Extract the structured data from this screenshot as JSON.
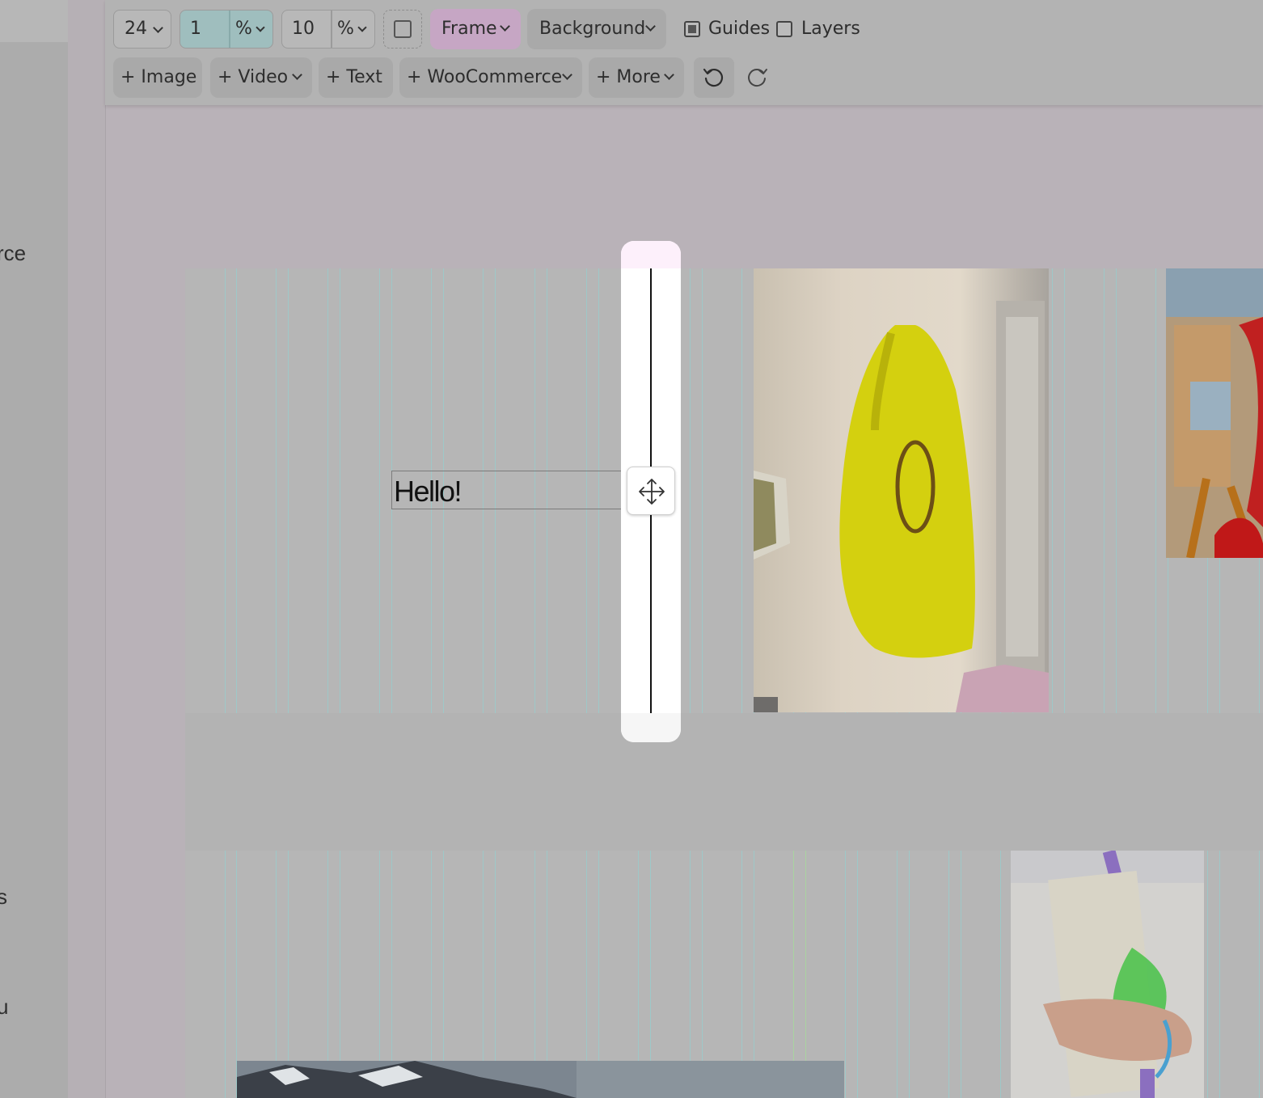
{
  "left_panel": {
    "fragments": [
      "rce",
      "s",
      "u"
    ]
  },
  "toolbar": {
    "columns": {
      "value": "24"
    },
    "gap": {
      "value": "1",
      "unit": "%"
    },
    "margin": {
      "value": "10",
      "unit": "%"
    },
    "frame_label": "Frame",
    "background_label": "Background",
    "guides_label": "Guides",
    "guides_checked": true,
    "layers_label": "Layers",
    "layers_checked": false,
    "add_image_label": "+ Image",
    "add_video_label": "+ Video",
    "add_text_label": "+ Text",
    "add_woocommerce_label": "+ WooCommerce",
    "add_more_label": "+ More"
  },
  "canvas": {
    "text_block": "Hello!",
    "colors": {
      "frame_button_bg": "#c6a6c4",
      "gap_input_bg": "#9fbebe",
      "guide_line": "#9ec8c8"
    }
  }
}
